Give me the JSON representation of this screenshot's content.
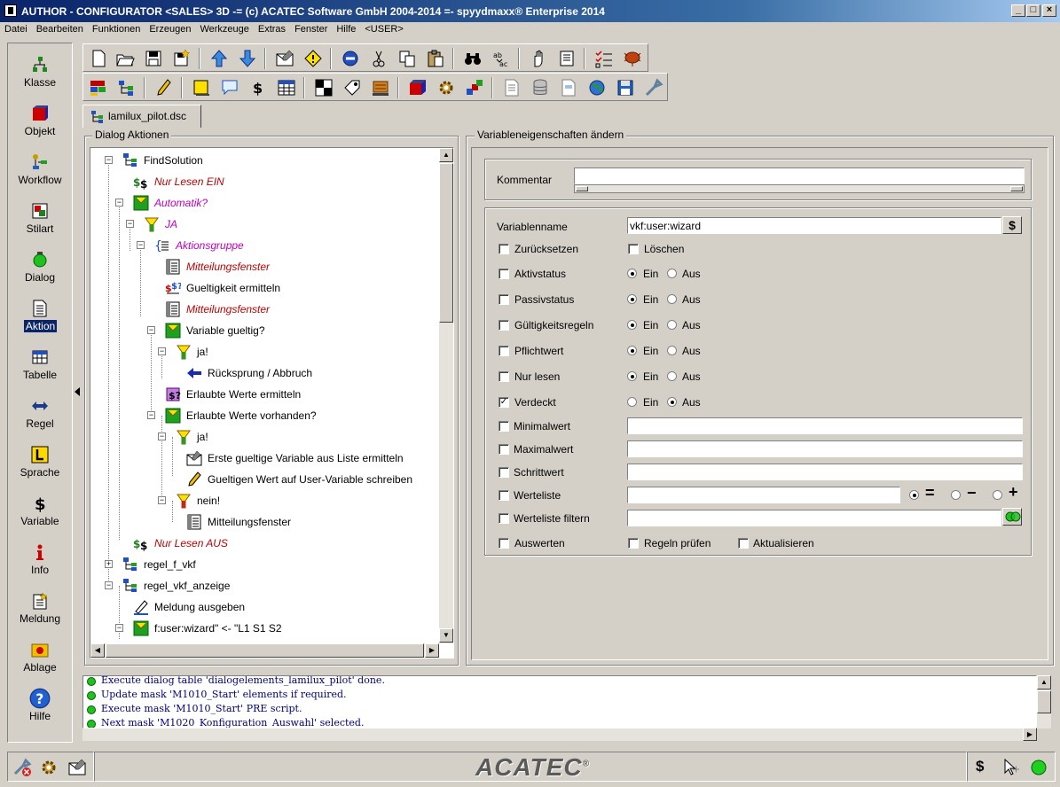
{
  "window": {
    "title": "AUTHOR - CONFIGURATOR <SALES> 3D  -= (c) ACATEC Software GmbH 2004-2014 =-   spyydmaxx® Enterprise 2014",
    "buttons": {
      "minimize": "_",
      "maximize": "□",
      "close": "×"
    }
  },
  "menu": [
    "Datei",
    "Bearbeiten",
    "Funktionen",
    "Erzeugen",
    "Werkzeuge",
    "Extras",
    "Fenster",
    "Hilfe",
    "<USER>"
  ],
  "sidebar": {
    "items": [
      {
        "label": "Klasse",
        "icon": "class-icon"
      },
      {
        "label": "Objekt",
        "icon": "object-icon"
      },
      {
        "label": "Workflow",
        "icon": "workflow-icon"
      },
      {
        "label": "Stilart",
        "icon": "style-icon"
      },
      {
        "label": "Dialog",
        "icon": "dialog-icon"
      },
      {
        "label": "Aktion",
        "icon": "action-icon",
        "selected": true
      },
      {
        "label": "Tabelle",
        "icon": "table-icon"
      },
      {
        "label": "Regel",
        "icon": "rule-icon"
      },
      {
        "label": "Sprache",
        "icon": "language-icon"
      },
      {
        "label": "Variable",
        "icon": "variable-icon"
      },
      {
        "label": "Info",
        "icon": "info-icon"
      },
      {
        "label": "Meldung",
        "icon": "message-icon"
      },
      {
        "label": "Ablage",
        "icon": "storage-icon"
      },
      {
        "label": "Hilfe",
        "icon": "help-icon"
      }
    ]
  },
  "tab": {
    "label": "lamilux_pilot.dsc"
  },
  "left_panel": {
    "title": "Dialog Aktionen",
    "tree": [
      {
        "label": "FindSolution",
        "style": "blk"
      },
      {
        "label": "Nur Lesen EIN",
        "style": "red"
      },
      {
        "label": "Automatik?",
        "style": "mag"
      },
      {
        "label": "JA",
        "style": "mag"
      },
      {
        "label": "Aktionsgruppe",
        "style": "mag"
      },
      {
        "label": "Mitteilungsfenster",
        "style": "red"
      },
      {
        "label": "Gueltigkeit ermitteln",
        "style": "blk"
      },
      {
        "label": "Mitteilungsfenster",
        "style": "red"
      },
      {
        "label": "Variable gueltig?",
        "style": "blk"
      },
      {
        "label": "ja!",
        "style": "blk"
      },
      {
        "label": "Rücksprung / Abbruch",
        "style": "blk"
      },
      {
        "label": "Erlaubte Werte ermitteln",
        "style": "blk"
      },
      {
        "label": "Erlaubte Werte vorhanden?",
        "style": "blk"
      },
      {
        "label": "ja!",
        "style": "blk"
      },
      {
        "label": "Erste gueltige Variable aus Liste ermitteln",
        "style": "blk"
      },
      {
        "label": "Gueltigen Wert auf  User-Variable schreiben",
        "style": "blk"
      },
      {
        "label": "nein!",
        "style": "blk"
      },
      {
        "label": "Mitteilungsfenster",
        "style": "blk"
      },
      {
        "label": "Nur Lesen AUS",
        "style": "red"
      },
      {
        "label": "regel_f_vkf",
        "style": "blk"
      },
      {
        "label": "regel_vkf_anzeige",
        "style": "blk"
      },
      {
        "label": "Meldung ausgeben",
        "style": "blk"
      },
      {
        "label": "f:user:wizard\" <- \"L1 S1 S2",
        "style": "blk"
      }
    ]
  },
  "right_panel": {
    "title": "Variableneigenschaften ändern",
    "comment_label": "Kommentar",
    "comment_value": "",
    "varname_label": "Variablenname",
    "varname_value": "vkf:user:wizard",
    "dollar_button": "$",
    "reset_label": "Zurücksetzen",
    "delete_label": "Löschen",
    "on_label": "Ein",
    "off_label": "Aus",
    "status_rows": [
      {
        "label": "Aktivstatus",
        "checked": false,
        "value": "Ein"
      },
      {
        "label": "Passivstatus",
        "checked": false,
        "value": "Ein"
      },
      {
        "label": "Gültigkeitsregeln",
        "checked": false,
        "value": "Ein"
      },
      {
        "label": "Pflichtwert",
        "checked": false,
        "value": "Ein"
      },
      {
        "label": "Nur lesen",
        "checked": false,
        "value": "Ein"
      },
      {
        "label": "Verdeckt",
        "checked": true,
        "value": "Aus"
      }
    ],
    "value_rows": [
      {
        "label": "Minimalwert",
        "value": ""
      },
      {
        "label": "Maximalwert",
        "value": ""
      },
      {
        "label": "Schrittwert",
        "value": ""
      },
      {
        "label": "Werteliste",
        "value": ""
      },
      {
        "label": "Werteliste filtern",
        "value": ""
      }
    ],
    "list_ops": {
      "selected": "=",
      "equal": "=",
      "minus": "−",
      "plus": "+"
    },
    "evaluate_label": "Auswerten",
    "check_rules_label": "Regeln prüfen",
    "update_label": "Aktualisieren"
  },
  "log": [
    "Execute dialog table 'dialogelements_lamilux_pilot' done.",
    "Update mask 'M1010_Start' elements if required.",
    "Execute mask 'M1010_Start' PRE script.",
    "Next mask 'M1020_Konfiguration_Auswahl' selected."
  ],
  "status": {
    "logo": "ACATEC",
    "logo_mark": "®",
    "dollar": "$"
  },
  "colors": {
    "title_start": "#0a246a",
    "title_end": "#a6caf0",
    "selection": "#0a246a",
    "red_label": "#c00000",
    "magenta_label": "#c000c0",
    "log_text": "#000080"
  }
}
